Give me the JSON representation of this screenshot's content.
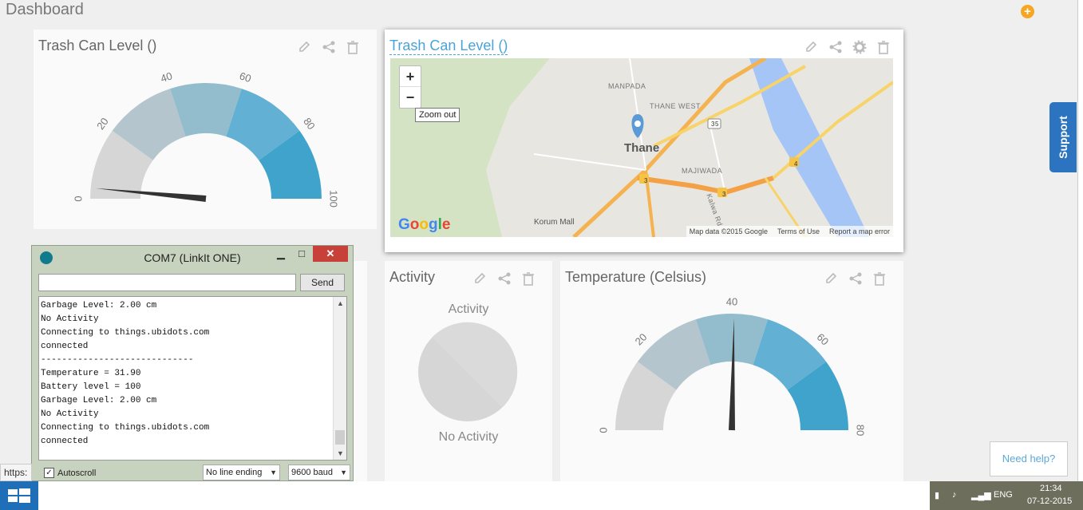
{
  "dashboard": {
    "title": "Dashboard"
  },
  "widgets": {
    "trash_gauge": {
      "title": "Trash Can Level ()",
      "ticks": [
        "0",
        "20",
        "40",
        "60",
        "80",
        "100"
      ],
      "value_percent": 3
    },
    "trash_map": {
      "title": "Trash Can Level ()",
      "zoom_in": "+",
      "zoom_out": "−",
      "zoom_tooltip": "Zoom out",
      "places": [
        "MANPADA",
        "THANE WEST",
        "MAJIWADA"
      ],
      "city": "Thane",
      "mall": "Korum Mall",
      "road_shields": [
        "3",
        "3",
        "4",
        "35"
      ],
      "road_label": "Kalwa Rd",
      "google": "Google",
      "footer": [
        "Map data ©2015 Google",
        "Terms of Use",
        "Report a map error"
      ]
    },
    "activity": {
      "title": "Activity",
      "chart_label": "Activity",
      "status": "No Activity"
    },
    "temperature": {
      "title": "Temperature (Celsius)",
      "ticks": [
        "0",
        "20",
        "40",
        "60",
        "80"
      ],
      "value": 40.5,
      "max": 80
    }
  },
  "serial_monitor": {
    "title": "COM7 (LinkIt ONE)",
    "input_value": "",
    "send_label": "Send",
    "lines": [
      "Garbage Level: 2.00 cm",
      "No Activity",
      "Connecting to things.ubidots.com",
      "connected",
      "-----------------------------",
      "Temperature = 31.90",
      "Battery level = 100",
      "Garbage Level: 2.00 cm",
      "No Activity",
      "Connecting to things.ubidots.com",
      "connected"
    ],
    "autoscroll_label": "Autoscroll",
    "line_ending": "No line ending",
    "baud": "9600 baud"
  },
  "status_url": "https:",
  "support_label": "Support",
  "need_help_label": "Need help?",
  "taskbar": {
    "lang": "ENG",
    "time": "21:34",
    "date": "07-12-2015"
  },
  "colors": {
    "gauge_bands": [
      "#d6d6d6",
      "#b4c5cd",
      "#93bccc",
      "#62b1d4",
      "#3fa3cc"
    ],
    "needle": "#333333",
    "accent_link": "#4aa3d8",
    "support": "#2c74c0",
    "add": "#f5a623"
  }
}
